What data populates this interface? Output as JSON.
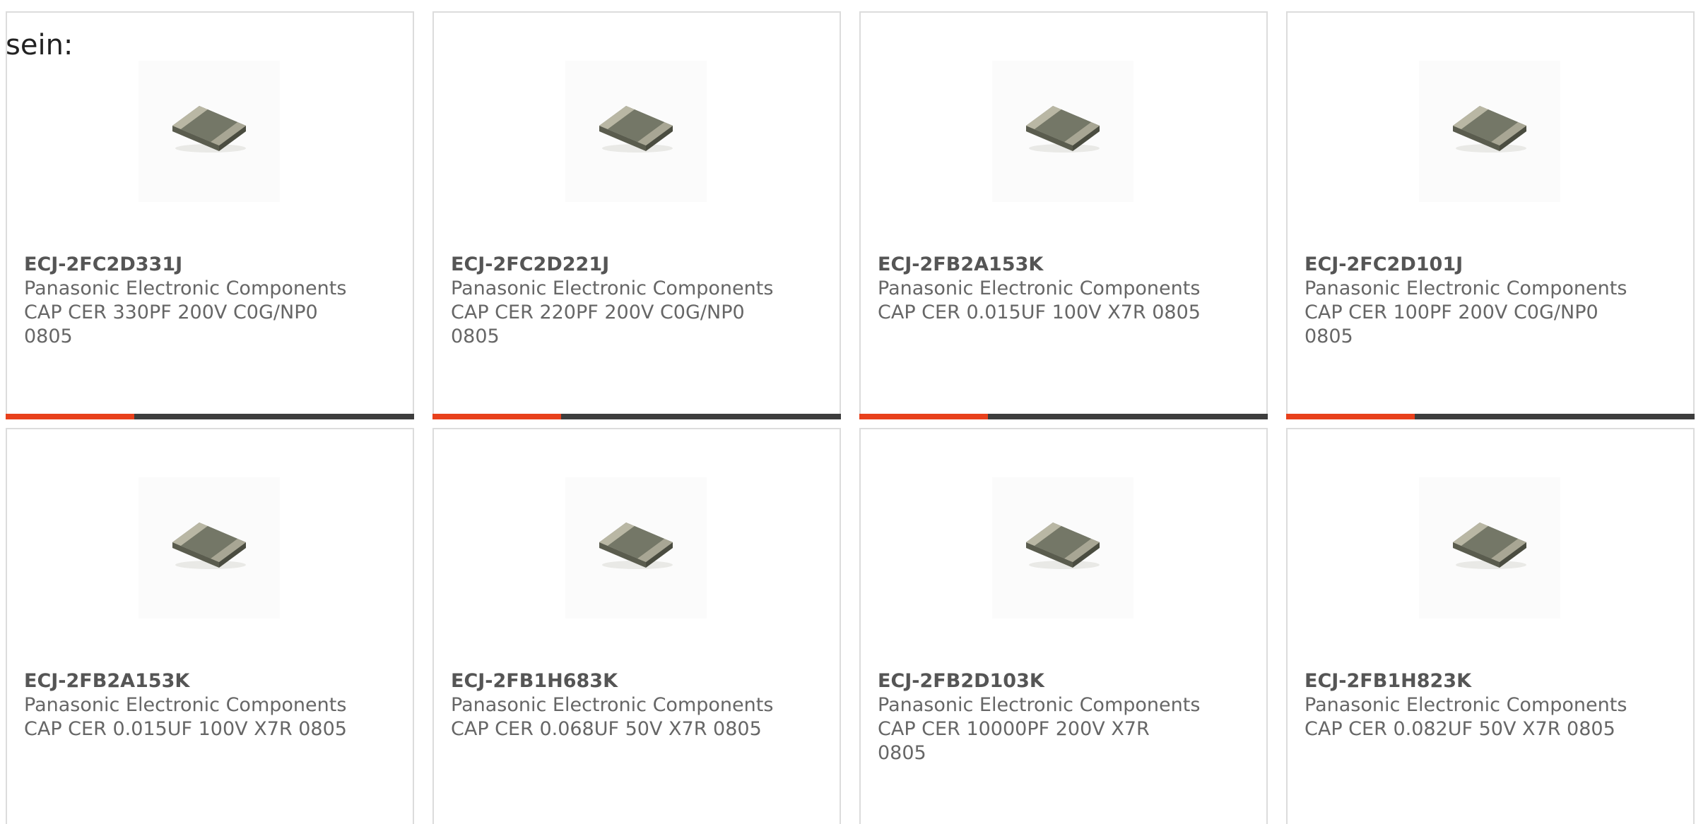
{
  "intro_text": "sein:",
  "colors": {
    "accent": "#e8401c",
    "bar": "#3d3d3d",
    "border": "#dcdcdc",
    "text": "#666666"
  },
  "products": [
    {
      "part_number": "ECJ-2FC2D331J",
      "manufacturer": "Panasonic Electronic Components",
      "description": "CAP CER 330PF 200V C0G/NP0 0805",
      "image_icon": "smd-capacitor-icon",
      "progress_fraction": 0.315
    },
    {
      "part_number": "ECJ-2FC2D221J",
      "manufacturer": "Panasonic Electronic Components",
      "description": "CAP CER 220PF 200V C0G/NP0 0805",
      "image_icon": "smd-capacitor-icon",
      "progress_fraction": 0.315
    },
    {
      "part_number": "ECJ-2FB2A153K",
      "manufacturer": "Panasonic Electronic Components",
      "description": "CAP CER 0.015UF 100V X7R 0805",
      "image_icon": "smd-capacitor-icon",
      "progress_fraction": 0.315
    },
    {
      "part_number": "ECJ-2FC2D101J",
      "manufacturer": "Panasonic Electronic Components",
      "description": "CAP CER 100PF 200V C0G/NP0 0805",
      "image_icon": "smd-capacitor-icon",
      "progress_fraction": 0.315
    },
    {
      "part_number": "ECJ-2FB2A153K",
      "manufacturer": "Panasonic Electronic Components",
      "description": "CAP CER 0.015UF 100V X7R 0805",
      "image_icon": "smd-capacitor-icon"
    },
    {
      "part_number": "ECJ-2FB1H683K",
      "manufacturer": "Panasonic Electronic Components",
      "description": "CAP CER 0.068UF 50V X7R 0805",
      "image_icon": "smd-capacitor-icon"
    },
    {
      "part_number": "ECJ-2FB2D103K",
      "manufacturer": "Panasonic Electronic Components",
      "description": "CAP CER 10000PF 200V X7R 0805",
      "image_icon": "smd-capacitor-icon"
    },
    {
      "part_number": "ECJ-2FB1H823K",
      "manufacturer": "Panasonic Electronic Components",
      "description": "CAP CER 0.082UF 50V X7R 0805",
      "image_icon": "smd-capacitor-icon"
    }
  ]
}
